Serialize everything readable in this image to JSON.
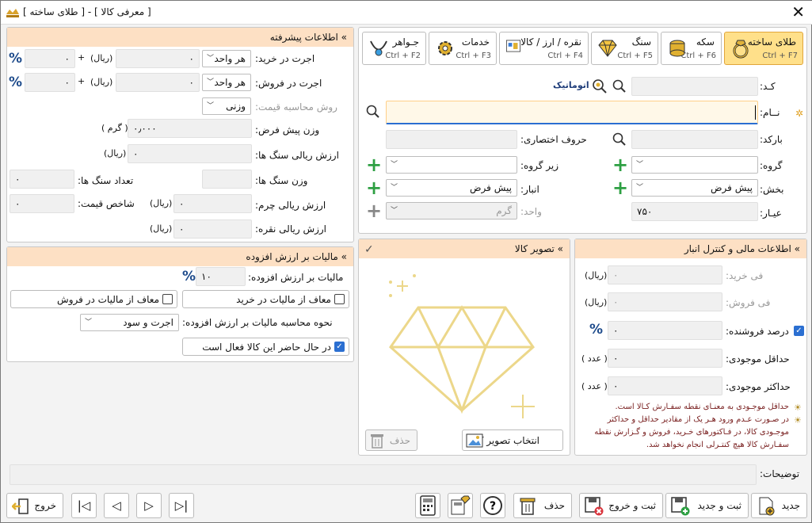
{
  "window": {
    "title": "[ معرفی کالا ] - [ طلای ساخته ]"
  },
  "tabs": [
    {
      "label": "طلای ساخته",
      "shortcut": "Ctrl + F7",
      "icon": "gold-ring-icon",
      "active": true
    },
    {
      "label": "سکه",
      "shortcut": "Ctrl + F6",
      "icon": "coin-stack-icon"
    },
    {
      "label": "سنگ",
      "shortcut": "Ctrl + F5",
      "icon": "diamond-icon"
    },
    {
      "label": "نقره / ارز / کالا",
      "shortcut": "Ctrl + F4",
      "icon": "goods-box-icon"
    },
    {
      "label": "خدمات",
      "shortcut": "Ctrl + F3",
      "icon": "service-gear-icon"
    },
    {
      "label": "جـواهر",
      "shortcut": "Ctrl + F2",
      "icon": "necklace-icon"
    }
  ],
  "main": {
    "code_label": "کـد:",
    "code_value": "",
    "auto_label": "اتوماتیک",
    "name_label": "نــام:",
    "name_value": "",
    "barcode_label": "بارکد:",
    "barcode_value": "",
    "abbr_label": "حروف اختصاری:",
    "abbr_value": "",
    "group_label": "گروه:",
    "group_value": "",
    "subgroup_label": "زیر گروه:",
    "subgroup_value": "",
    "section_label": "بخش:",
    "section_value": "پیش فرض",
    "warehouse_label": "انبار:",
    "warehouse_value": "پیش فرض",
    "karat_label": "عیـار:",
    "karat_value": "۷۵۰",
    "unit_label": "واحد:",
    "unit_value": "گرم"
  },
  "advanced": {
    "title": "» اطلاعات پیشرفته",
    "buy_wage_label": "اجرت در خرید:",
    "buy_wage_mode": "هر واحد",
    "buy_wage_value": "۰",
    "buy_wage_unit": "(ریال)",
    "buy_wage_plus": "+",
    "buy_wage_pct": "۰",
    "sell_wage_label": "اجرت در فروش:",
    "sell_wage_mode": "هر واحد",
    "sell_wage_value": "۰",
    "sell_wage_unit": "(ریال)",
    "sell_wage_plus": "+",
    "sell_wage_pct": "۰",
    "price_method_label": "روش محاسبه قیمت:",
    "price_method_value": "وزنی",
    "default_weight_label": "وزن پیش فرض:",
    "default_weight_value": "۰٫۰۰۰",
    "default_weight_unit": "( گرم )",
    "stone_rial_label": "ارزش ریالی سنگ ها:",
    "stone_rial_value": "۰",
    "stone_rial_unit": "(ریال)",
    "stone_weight_label": "وزن سنگ ها:",
    "stone_weight_value": "",
    "stone_count_label": "تعداد سنگ ها:",
    "stone_count_value": "۰",
    "leather_rial_label": "ارزش ریالی چرم:",
    "leather_rial_value": "۰",
    "leather_rial_unit": "(ریال)",
    "price_index_label": "شاخص قیمت:",
    "price_index_value": "۰",
    "silver_rial_label": "ارزش ریالی نقره:",
    "silver_rial_value": "۰",
    "silver_rial_unit": "(ریال)",
    "pct_symbol": "%"
  },
  "vat": {
    "title": "» مالیات بر ارزش افزوده",
    "rate_label": "مالیات بر ارزش افزوده:",
    "rate_value": "۱۰",
    "pct_symbol": "%",
    "exempt_buy": "معاف از مالیات در خرید",
    "exempt_sell": "معاف از مالیات در فروش",
    "calc_label": "نحوه محاسبه مالیات بر ارزش افزوده:",
    "calc_value": "اجرت و سود",
    "active_label": "در حال حاضر این کالا فعال است"
  },
  "image": {
    "title": "» تصویر کالا",
    "select_label": "انتخاب تصویر کالا",
    "delete_label": "حذف"
  },
  "finance": {
    "title": "» اطلاعات مالی و کنترل انبار",
    "buy_price_label": "فی خرید:",
    "buy_price_unit": "(ریال)",
    "buy_price_value": "۰",
    "sell_price_label": "فی فروش:",
    "sell_price_unit": "(ریال)",
    "sell_price_value": "۰",
    "seller_pct_label": "درصد فروشنده:",
    "seller_pct_value": "۰",
    "pct_symbol": "%",
    "min_stock_label": "حداقل موجودی:",
    "min_stock_unit": "( عدد )",
    "min_stock_value": "۰",
    "max_stock_label": "حداکثر موجودی:",
    "max_stock_unit": "( عدد )",
    "max_stock_value": "۰",
    "note1": "حداقل موجـودی به معنـای نقطه سفـارش کـالا است.",
    "note2": "در صـورت عـدم ورود هـر یک از مقادیر حداقل و حداکثر",
    "note3": "موجـودی کالا، در فـاکتورهای خـرید، فروش و گـزارش نقطه",
    "note4": "سفـارش کالا هیچ کنتـرلی انجام نخواهد شد."
  },
  "description": {
    "label": "توضیحات:",
    "value": ""
  },
  "toolbar": {
    "new": "جدید",
    "save_new": "ثبت و جدید",
    "save_exit": "ثبت و خروج",
    "delete": "حذف",
    "exit": "خروج"
  }
}
